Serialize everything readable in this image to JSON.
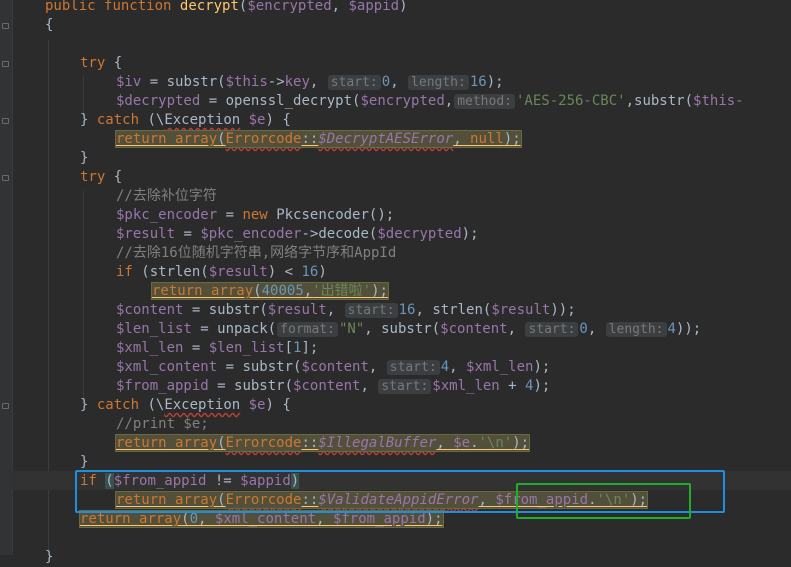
{
  "editor": {
    "lines": {
      "l1": {
        "kw_public": "public",
        "kw_function": "function",
        "fname": "decrypt",
        "p1": "$encrypted",
        "p2": "$appid"
      },
      "l2": {
        "brace": "{"
      },
      "l4": {
        "kw_try": "try"
      },
      "l5": {
        "var": "$iv",
        "func": "substr",
        "this": "$this",
        "prop": "key",
        "hint1": "start:",
        "num1": "0",
        "hint2": "length:",
        "num2": "16"
      },
      "l6": {
        "var": "$decrypted",
        "func": "openssl_decrypt",
        "arg": "$encrypted",
        "hint": "method:",
        "str": "'AES-256-CBC'",
        "func2": "substr",
        "this": "$this-"
      },
      "l7": {
        "kw_catch": "catch",
        "cls": "Exception",
        "var": "$e"
      },
      "l8": {
        "kw_return": "return",
        "kw_array": "array",
        "cls": "Errorcode",
        "sprop": "$DecryptAESError",
        "kw_null": "null"
      },
      "l9": {
        "brace": "}"
      },
      "l10": {
        "kw_try": "try"
      },
      "l11": {
        "comment": "//去除补位字符"
      },
      "l12": {
        "var": "$pkc_encoder",
        "kw_new": "new",
        "cls": "Pkcsencoder"
      },
      "l13": {
        "var": "$result",
        "obj": "$pkc_encoder",
        "func": "decode",
        "arg": "$decrypted"
      },
      "l14": {
        "comment": "//去除16位随机字符串,网络字节序和AppId"
      },
      "l15": {
        "kw_if": "if",
        "func": "strlen",
        "var": "$result",
        "num": "16"
      },
      "l16": {
        "kw_return": "return",
        "kw_array": "array",
        "num": "40005",
        "str": "'出错啦'"
      },
      "l17": {
        "var": "$content",
        "func": "substr",
        "arg": "$result",
        "hint": "start:",
        "num": "16",
        "func2": "strlen",
        "arg2": "$result"
      },
      "l18": {
        "var": "$len_list",
        "func": "unpack",
        "hint1": "format:",
        "str": "\"N\"",
        "func2": "substr",
        "arg": "$content",
        "hint2": "start:",
        "num1": "0",
        "hint3": "length:",
        "num2": "4"
      },
      "l19": {
        "var": "$xml_len",
        "var2": "$len_list",
        "num": "1"
      },
      "l20": {
        "var": "$xml_content",
        "func": "substr",
        "arg": "$content",
        "hint": "start:",
        "num": "4",
        "arg2": "$xml_len"
      },
      "l21": {
        "var": "$from_appid",
        "func": "substr",
        "arg": "$content",
        "hint": "start:",
        "arg2": "$xml_len",
        "num": "4"
      },
      "l22": {
        "kw_catch": "catch",
        "cls": "Exception",
        "var": "$e"
      },
      "l23": {
        "comment": "//print $e;"
      },
      "l24": {
        "kw_return": "return",
        "kw_array": "array",
        "cls": "Errorcode",
        "sprop": "$IllegalBuffer",
        "var": "$e",
        "str": "'\\n'"
      },
      "l25": {
        "brace": "}"
      },
      "l26": {
        "kw_if": "if",
        "var": "$from_appid",
        "var2": "$appid"
      },
      "l27": {
        "kw_return": "return",
        "kw_array": "array",
        "cls": "Errorcode",
        "sprop": "$ValidateAppidError",
        "var": "$from_appid",
        "str": "'\\n'"
      },
      "l28": {
        "kw_return": "return",
        "kw_array": "array",
        "num": "0",
        "var": "$xml_content",
        "var2": "$from_appid"
      },
      "l30": {
        "brace": "}"
      }
    }
  },
  "annotations": {
    "blue_box_color": "#1d8fe0",
    "green_box_color": "#1fae29"
  },
  "colors": {
    "background": "#2b2b2b",
    "keyword": "#cc7832",
    "function": "#ffc66d",
    "variable": "#9876aa",
    "string": "#6a8759",
    "number": "#6897bb",
    "comment": "#808080",
    "text": "#a9b7c6"
  }
}
